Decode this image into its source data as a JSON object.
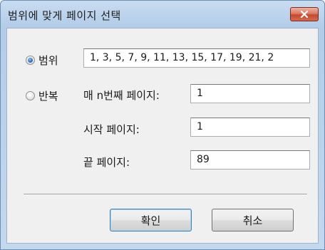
{
  "window": {
    "title": "범위에 맞게 페이지 선택"
  },
  "options": {
    "range_label": "범위",
    "range_value": "1, 3, 5, 7, 9, 11, 13, 15, 17, 19, 21, 2",
    "repeat_label": "반복",
    "selected": "range"
  },
  "repeat_fields": {
    "every_nth_label": "매 n번째 페이지:",
    "every_nth_value": "1",
    "start_page_label": "시작 페이지:",
    "start_page_value": "1",
    "end_page_label": "끝 페이지:",
    "end_page_value": "89"
  },
  "buttons": {
    "ok_label": "확인",
    "cancel_label": "취소"
  },
  "icons": {
    "close": "close-icon"
  },
  "colors": {
    "close_button": "#c44a2e",
    "radio_selected": "#2a6fc0"
  }
}
